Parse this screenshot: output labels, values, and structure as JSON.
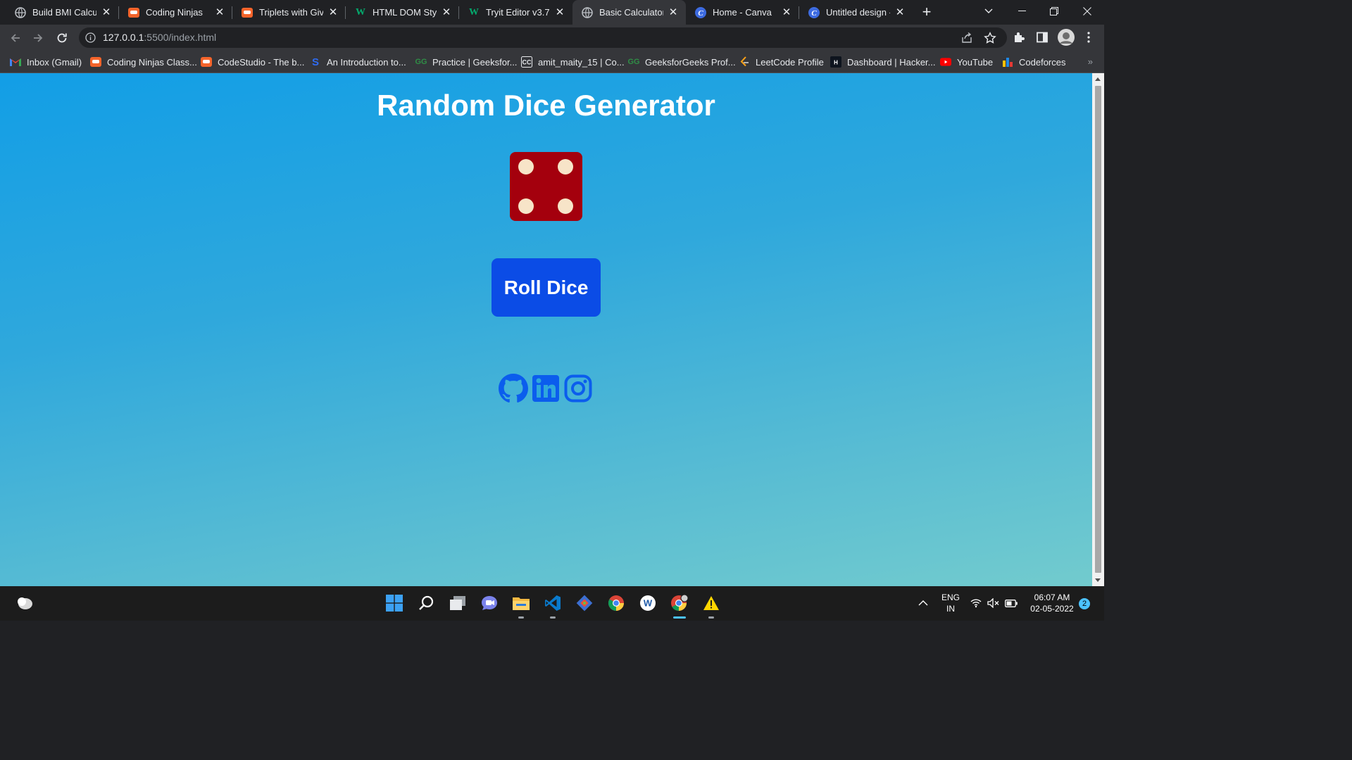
{
  "tabs": [
    {
      "title": "Build BMI Calcula",
      "icon": "globe-icon",
      "active": false
    },
    {
      "title": "Coding Ninjas",
      "icon": "coding-ninjas-icon",
      "active": false
    },
    {
      "title": "Triplets with Give",
      "icon": "coding-ninjas-icon",
      "active": false
    },
    {
      "title": "HTML DOM Style",
      "icon": "w3schools-icon",
      "active": false
    },
    {
      "title": "Tryit Editor v3.7",
      "icon": "w3schools-icon",
      "active": false
    },
    {
      "title": "Basic Calculator",
      "icon": "globe-icon",
      "active": true
    },
    {
      "title": "Home - Canva",
      "icon": "canva-icon",
      "active": false
    },
    {
      "title": "Untitled design -",
      "icon": "canva-icon",
      "active": false
    }
  ],
  "omnibox": {
    "host": "127.0.0.1",
    "path": ":5500/index.html"
  },
  "bookmarks": [
    {
      "label": "Inbox (Gmail)",
      "icon": "gmail-icon"
    },
    {
      "label": "Coding Ninjas Class...",
      "icon": "coding-ninjas-icon"
    },
    {
      "label": "CodeStudio - The b...",
      "icon": "coding-ninjas-icon"
    },
    {
      "label": "An Introduction to...",
      "icon": "s-icon"
    },
    {
      "label": "Practice | Geeksfor...",
      "icon": "gfg-icon"
    },
    {
      "label": "amit_maity_15 | Co...",
      "icon": "codechef-icon"
    },
    {
      "label": "GeeksforGeeks Prof...",
      "icon": "gfg-icon"
    },
    {
      "label": "LeetCode Profile",
      "icon": "leetcode-icon"
    },
    {
      "label": "Dashboard | Hacker...",
      "icon": "hackerrank-icon"
    },
    {
      "label": "YouTube",
      "icon": "youtube-icon"
    },
    {
      "label": "Codeforces",
      "icon": "codeforces-icon"
    }
  ],
  "bookmarks_more": "»",
  "page": {
    "title": "Random Dice Generator",
    "dice_value": 4,
    "roll_button": "Roll Dice",
    "social": [
      "github-icon",
      "linkedin-icon",
      "instagram-icon"
    ]
  },
  "colors": {
    "bg_top": "#129ee6",
    "bg_bottom": "#72cbce",
    "dice": "#a4000d",
    "pip": "#f7e4c8",
    "button": "#0b4ce6",
    "social": "#0b5ded"
  },
  "taskbar": {
    "apps": [
      "weather-icon",
      "windows-start-icon",
      "search-icon",
      "task-view-icon",
      "teams-chat-icon",
      "file-explorer-icon",
      "vscode-icon",
      "git-icon",
      "chrome-icon",
      "word-icon",
      "chrome-profile-icon",
      "warning-icon"
    ],
    "lang_top": "ENG",
    "lang_bottom": "IN",
    "time": "06:07 AM",
    "date": "02-05-2022",
    "notifications": "2"
  }
}
